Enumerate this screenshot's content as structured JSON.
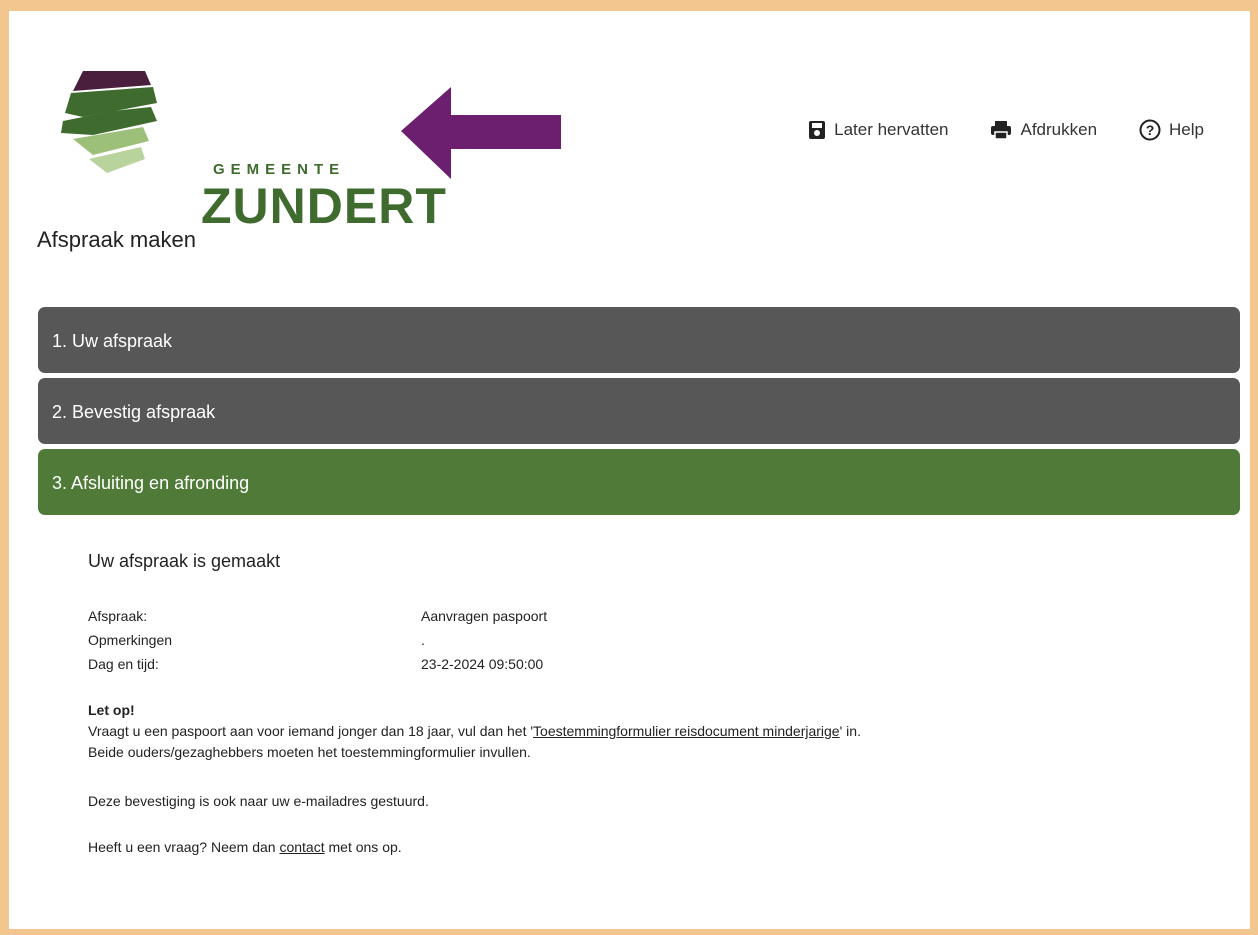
{
  "header": {
    "logo": {
      "subtitle": "GEMEENTE",
      "name": "ZUNDERT",
      "colors": {
        "green": "#3f6b2f",
        "purple": "#4a1f3d",
        "light_green": "#9cbf7a"
      }
    },
    "arrow": {
      "color": "#6b1f6e",
      "direction": "left"
    },
    "tools": [
      {
        "label": "Later hervatten",
        "icon": "save-icon"
      },
      {
        "label": "Afdrukken",
        "icon": "printer-icon"
      },
      {
        "label": "Help",
        "icon": "help-circle-icon"
      }
    ]
  },
  "page": {
    "title": "Afspraak maken"
  },
  "steps": [
    {
      "label": "1. Uw afspraak",
      "state": "inactive",
      "color": "#575757"
    },
    {
      "label": "2. Bevestig afspraak",
      "state": "inactive",
      "color": "#575757"
    },
    {
      "label": "3. Afsluiting en afronding",
      "state": "active",
      "color": "#4f7a37"
    }
  ],
  "confirmation": {
    "heading": "Uw afspraak is gemaakt",
    "details": [
      {
        "label": "Afspraak:",
        "value": "Aanvragen paspoort"
      },
      {
        "label": "Opmerkingen",
        "value": "."
      },
      {
        "label": "Dag en tijd:",
        "value": "23-2-2024 09:50:00"
      }
    ],
    "notice": {
      "title": "Let op!",
      "line1_before": "Vraagt u een paspoort aan voor iemand jonger dan 18 jaar, vul dan het '",
      "line1_link": "Toestemmingformulier reisdocument minderjarige",
      "line1_after": "' in.",
      "line2": "Beide ouders/gezaghebbers moeten het toestemmingformulier invullen."
    },
    "email_note": "Deze bevestiging is ook naar uw e-mailadres gestuurd.",
    "question_before": "Heeft u een vraag? Neem dan ",
    "question_link": "contact",
    "question_after": " met ons op."
  },
  "colors": {
    "frame_border": "#f3c68f",
    "background": "#ffffff"
  }
}
